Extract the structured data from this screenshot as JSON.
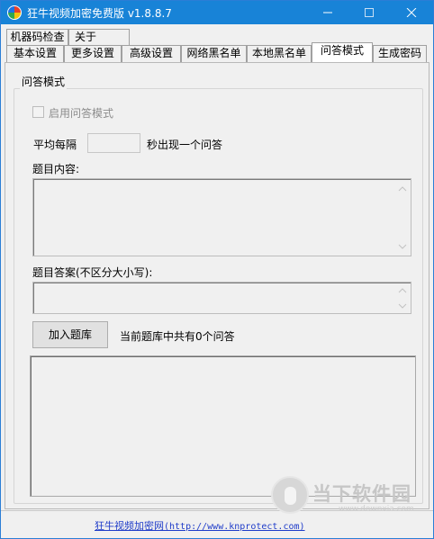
{
  "window": {
    "title": "狂牛视频加密免费版 v1.8.8.7",
    "controls": {
      "minimize": "—",
      "maximize": "☐",
      "close": "✕"
    }
  },
  "tabs": {
    "row_top": [
      {
        "label": "机器码检查"
      },
      {
        "label": "关于"
      }
    ],
    "row_bottom": [
      {
        "label": "基本设置"
      },
      {
        "label": "更多设置"
      },
      {
        "label": "高级设置"
      },
      {
        "label": "网络黑名单"
      },
      {
        "label": "本地黑名单"
      },
      {
        "label": "问答模式",
        "active": true
      },
      {
        "label": "生成密码"
      }
    ]
  },
  "qa_panel": {
    "group_title": "问答模式",
    "enable_checkbox": {
      "label": "启用问答模式",
      "checked": false,
      "disabled": true
    },
    "interval": {
      "prefix": "平均每隔",
      "value": "",
      "suffix": "秒出现一个问答"
    },
    "question_label": "题目内容:",
    "question_value": "",
    "answer_label": "题目答案(不区分大小写):",
    "answer_value": "",
    "add_button": "加入题库",
    "count_text": "当前题库中共有0个问答",
    "results_value": ""
  },
  "watermark": {
    "brand": "当下软件园",
    "url": "www.downxia.com"
  },
  "footer": {
    "site_name": "狂牛视频加密网",
    "site_url": "(http://www.knprotect.com)"
  },
  "colors": {
    "titlebar": "#1883d7",
    "link": "#1f3cc9"
  }
}
